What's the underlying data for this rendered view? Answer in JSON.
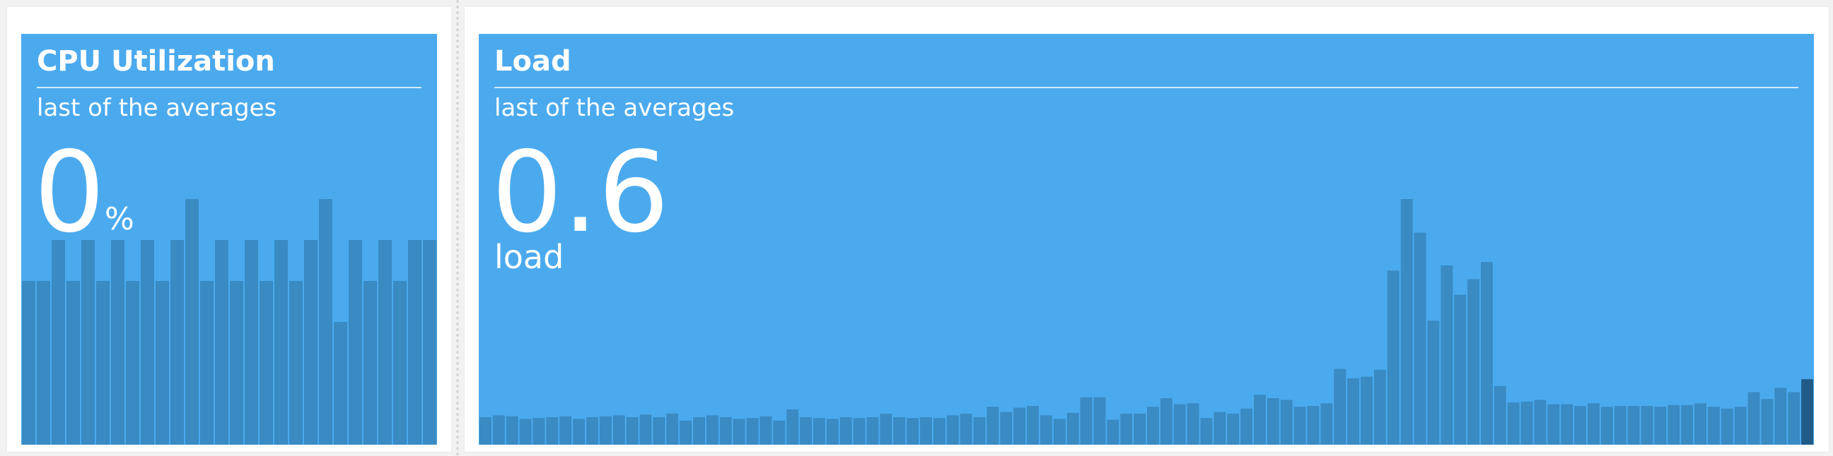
{
  "widgets": {
    "cpu": {
      "title": "CPU Utilization",
      "subtitle": "last of the averages",
      "value": "0",
      "unit": "%",
      "bar_levels": [
        4,
        4,
        5,
        4,
        5,
        4,
        5,
        4,
        5,
        4,
        5,
        6,
        4,
        5,
        4,
        5,
        4,
        5,
        4,
        5,
        6,
        3,
        5,
        4,
        5,
        4,
        5,
        5
      ],
      "bar_max": 6
    },
    "load": {
      "title": "Load",
      "subtitle": "last of the averages",
      "value": "0.6",
      "unit": "load",
      "bar_levels": [
        3.2,
        3.4,
        3.3,
        3.0,
        3.1,
        3.2,
        3.3,
        3.0,
        3.2,
        3.3,
        3.4,
        3.2,
        3.5,
        3.2,
        3.6,
        2.8,
        3.2,
        3.4,
        3.2,
        3.0,
        3.1,
        3.3,
        2.8,
        4.1,
        3.2,
        3.1,
        3.0,
        3.2,
        3.1,
        3.2,
        3.6,
        3.2,
        3.1,
        3.2,
        3.1,
        3.4,
        3.6,
        3.2,
        4.4,
        3.8,
        4.3,
        4.5,
        3.4,
        3.0,
        3.7,
        5.5,
        5.5,
        2.9,
        3.6,
        3.6,
        4.4,
        5.4,
        4.7,
        4.8,
        3.1,
        3.8,
        3.6,
        4.2,
        5.8,
        5.4,
        5.2,
        4.4,
        4.5,
        4.8,
        8.8,
        7.7,
        7.9,
        8.7,
        20.2,
        28.5,
        24.6,
        14.4,
        20.8,
        17.4,
        19.2,
        21.2,
        6.8,
        4.9,
        5.0,
        5.2,
        4.7,
        4.7,
        4.5,
        4.8,
        4.4,
        4.5,
        4.5,
        4.5,
        4.4,
        4.6,
        4.6,
        4.8,
        4.4,
        4.2,
        4.4,
        6.1,
        5.3,
        6.6,
        6.1,
        7.6
      ]
    }
  }
}
